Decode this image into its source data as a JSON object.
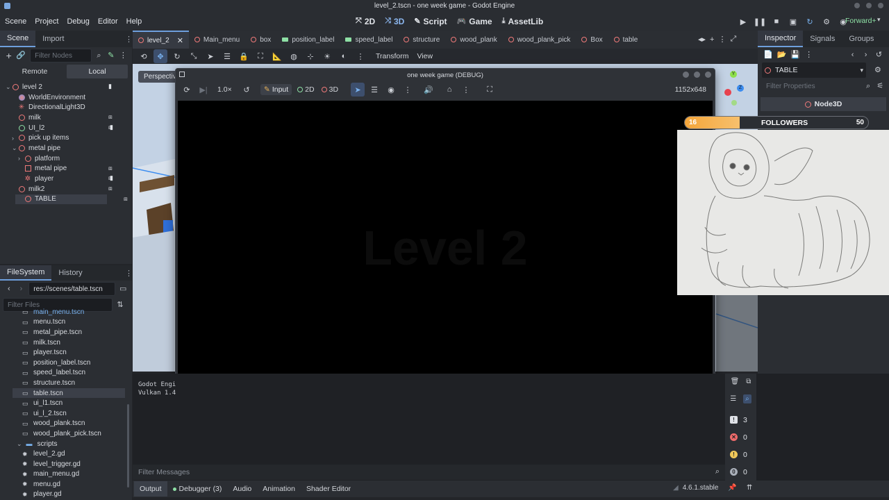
{
  "window_title": "level_2.tscn - one week game - Godot Engine",
  "menu": {
    "items": [
      "Scene",
      "Project",
      "Debug",
      "Editor",
      "Help"
    ]
  },
  "main_tabs": [
    {
      "label": "2D",
      "icon": "2d-icon",
      "active": false
    },
    {
      "label": "3D",
      "icon": "3d-icon",
      "active": true
    },
    {
      "label": "Script",
      "icon": "script-icon",
      "active": false
    },
    {
      "label": "Game",
      "icon": "game-icon",
      "active": false
    },
    {
      "label": "AssetLib",
      "icon": "assetlib-icon",
      "active": false
    }
  ],
  "renderer": "Forward+",
  "scene_dock": {
    "tabs": [
      "Scene",
      "Import"
    ],
    "filter_placeholder": "Filter Nodes",
    "remote_label": "Remote",
    "local_label": "Local",
    "nodes": [
      {
        "label": "level 2",
        "depth": 0,
        "icon": "node3d-icon",
        "expanded": true
      },
      {
        "label": "WorldEnvironment",
        "depth": 1,
        "icon": "world-environment-icon"
      },
      {
        "label": "DirectionalLight3D",
        "depth": 1,
        "icon": "directional-light-icon"
      },
      {
        "label": "milk",
        "depth": 1,
        "icon": "node3d-icon"
      },
      {
        "label": "UI_l2",
        "depth": 1,
        "icon": "control-icon"
      },
      {
        "label": "pick up items",
        "depth": 1,
        "icon": "node3d-icon",
        "collapsed": true
      },
      {
        "label": "metal pipe",
        "depth": 1,
        "icon": "node3d-icon",
        "expanded": true
      },
      {
        "label": "platform",
        "depth": 2,
        "icon": "node3d-icon",
        "collapsed": true
      },
      {
        "label": "metal pipe",
        "depth": 2,
        "icon": "mesh-icon"
      },
      {
        "label": "player",
        "depth": 2,
        "icon": "character-icon"
      },
      {
        "label": "milk2",
        "depth": 1,
        "icon": "node3d-icon"
      },
      {
        "label": "TABLE",
        "depth": 1,
        "icon": "node3d-icon",
        "selected": true
      }
    ]
  },
  "filesystem_dock": {
    "tabs": [
      "FileSystem",
      "History"
    ],
    "path": "res://scenes/table.tscn",
    "filter_placeholder": "Filter Files",
    "files": [
      {
        "label": "main_menu.tscn",
        "icon": "scene-file-icon"
      },
      {
        "label": "menu.tscn",
        "icon": "scene-file-icon"
      },
      {
        "label": "metal_pipe.tscn",
        "icon": "scene-file-icon"
      },
      {
        "label": "milk.tscn",
        "icon": "scene-file-icon"
      },
      {
        "label": "player.tscn",
        "icon": "scene-file-icon"
      },
      {
        "label": "position_label.tscn",
        "icon": "scene-file-icon"
      },
      {
        "label": "speed_label.tscn",
        "icon": "scene-file-icon"
      },
      {
        "label": "structure.tscn",
        "icon": "scene-file-icon"
      },
      {
        "label": "table.tscn",
        "icon": "scene-file-icon",
        "selected": true
      },
      {
        "label": "ui_l1.tscn",
        "icon": "scene-file-icon"
      },
      {
        "label": "ui_l_2.tscn",
        "icon": "scene-file-icon"
      },
      {
        "label": "wood_plank.tscn",
        "icon": "scene-file-icon"
      },
      {
        "label": "wood_plank_pick.tscn",
        "icon": "scene-file-icon"
      },
      {
        "label": "scripts",
        "icon": "folder-icon",
        "folder": true
      },
      {
        "label": "level_2.gd",
        "icon": "gear-icon"
      },
      {
        "label": "level_trigger.gd",
        "icon": "gear-icon"
      },
      {
        "label": "main_menu.gd",
        "icon": "gear-icon"
      },
      {
        "label": "menu.gd",
        "icon": "gear-icon"
      },
      {
        "label": "player.gd",
        "icon": "gear-icon"
      }
    ]
  },
  "scene_tabs": [
    {
      "label": "level_2",
      "icon": "node-red",
      "active": true
    },
    {
      "label": "Main_menu",
      "icon": "node-red"
    },
    {
      "label": "box",
      "icon": "node-red"
    },
    {
      "label": "position_label",
      "icon": "node-green"
    },
    {
      "label": "speed_label",
      "icon": "node-green"
    },
    {
      "label": "structure",
      "icon": "node-red"
    },
    {
      "label": "wood_plank",
      "icon": "node-red"
    },
    {
      "label": "wood_plank_pick",
      "icon": "node-red"
    },
    {
      "label": "Box",
      "icon": "node-red"
    },
    {
      "label": "table",
      "icon": "node-red"
    }
  ],
  "viewport_toolbar": {
    "transform_label": "Transform",
    "view_label": "View",
    "perspective_label": "Perspective"
  },
  "game_window": {
    "title": "one week game (DEBUG)",
    "speed": "1.0×",
    "input_label": "Input",
    "mode_2d": "2D",
    "mode_3d": "3D",
    "resolution": "1152x648",
    "level_text": "Level 2"
  },
  "inspector": {
    "tabs": [
      "Inspector",
      "Signals",
      "Groups"
    ],
    "node_name": "TABLE",
    "filter_placeholder": "Filter Properties",
    "section": "Node3D"
  },
  "overlay": {
    "level": "16",
    "followers_label": "FOLLOWERS",
    "followers_count": "50",
    "progress": 0.3
  },
  "output": {
    "lines": [
      "Godot Engi",
      "Vulkan 1.4"
    ],
    "filter_placeholder": "Filter Messages",
    "counters": [
      {
        "value": "3",
        "icon": "message-icon",
        "color": "#dfe2e7"
      },
      {
        "value": "0",
        "icon": "error-icon",
        "color": "#ef6b6b"
      },
      {
        "value": "0",
        "icon": "warning-icon",
        "color": "#f0c85a"
      },
      {
        "value": "0",
        "icon": "info-icon",
        "color": "#aab0ba"
      }
    ]
  },
  "bottom_tabs": [
    {
      "label": "Output",
      "active": true
    },
    {
      "label": "Debugger (3)",
      "dot": true
    },
    {
      "label": "Audio"
    },
    {
      "label": "Animation"
    },
    {
      "label": "Shader Editor"
    }
  ],
  "version": "4.6.1.stable",
  "colors": {
    "accent": "#6e9fdd",
    "node_red": "#f07a7a",
    "node_green": "#8ee0a5",
    "progress_orange": "#f4a53a",
    "sky": "#c3d2e4"
  }
}
